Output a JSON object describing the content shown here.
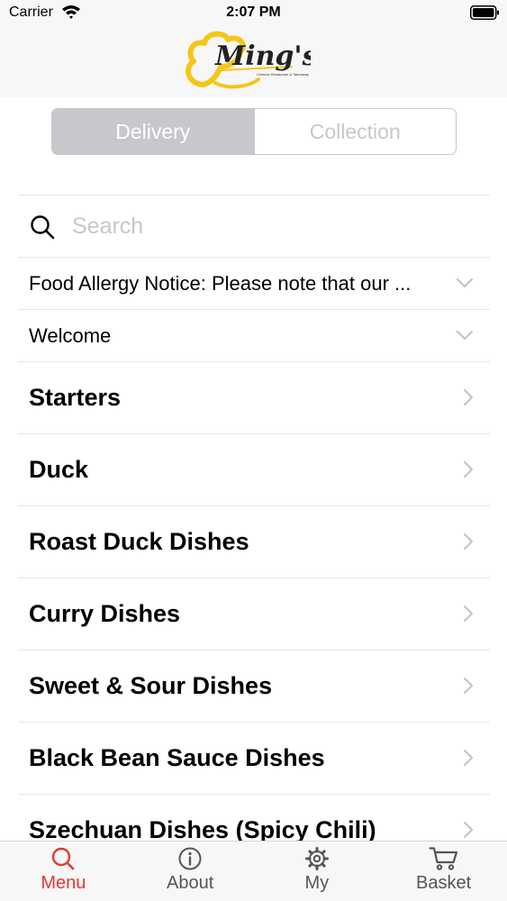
{
  "status_bar": {
    "carrier": "Carrier",
    "time": "2:07 PM"
  },
  "header": {
    "logo_text": "Ming's",
    "logo_subtext": "Chinese Restaurant & Takeaway"
  },
  "order_mode": {
    "options": [
      "Delivery",
      "Collection"
    ],
    "selected": "Delivery"
  },
  "search": {
    "placeholder": "Search",
    "value": ""
  },
  "notices": [
    {
      "label": "Food Allergy Notice: Please note that our ..."
    },
    {
      "label": "Welcome"
    }
  ],
  "categories": [
    {
      "label": "Starters"
    },
    {
      "label": "Duck"
    },
    {
      "label": "Roast Duck Dishes"
    },
    {
      "label": "Curry Dishes"
    },
    {
      "label": "Sweet & Sour Dishes"
    },
    {
      "label": "Black Bean Sauce Dishes"
    },
    {
      "label": "Szechuan Dishes (Spicy Chili)"
    }
  ],
  "tabbar": {
    "tabs": [
      {
        "label": "Menu",
        "icon": "search-icon"
      },
      {
        "label": "About",
        "icon": "info-icon"
      },
      {
        "label": "My",
        "icon": "gear-icon"
      },
      {
        "label": "Basket",
        "icon": "cart-icon"
      }
    ],
    "active": "Menu"
  },
  "colors": {
    "accent": "#e03a2f",
    "logo_yellow": "#f5c518",
    "segment_gray": "#c7c7cc"
  }
}
